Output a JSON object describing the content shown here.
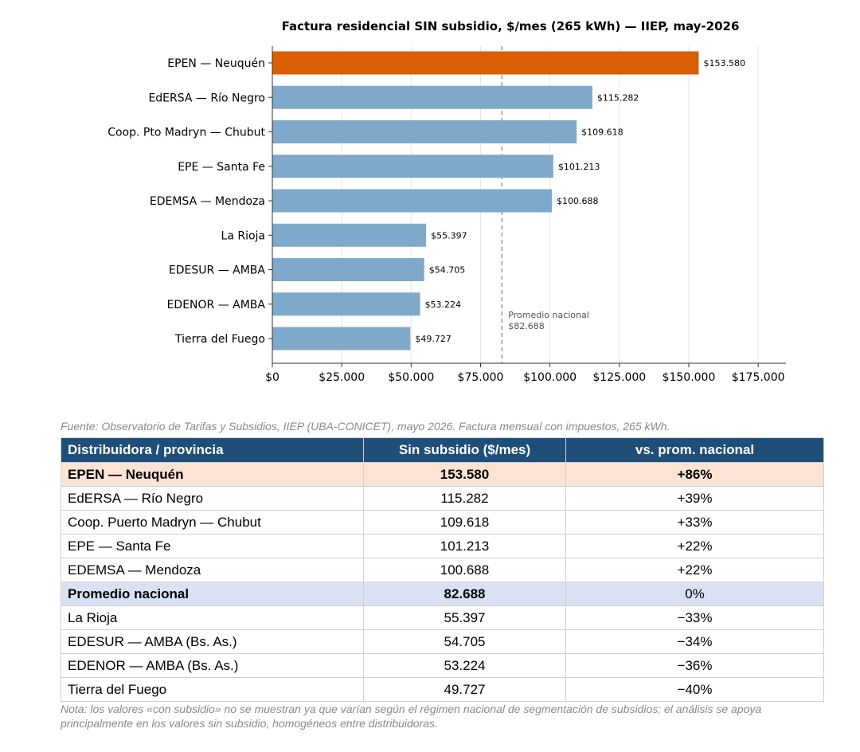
{
  "chart_data": {
    "type": "bar",
    "orientation": "horizontal",
    "title": "Factura residencial SIN subsidio, $/mes (265 kWh) — IIEP, may-2026",
    "categories": [
      "EPEN — Neuquén",
      "EdERSA — Río Negro",
      "Coop. Pto Madryn — Chubut",
      "EPE — Santa Fe",
      "EDEMSA — Mendoza",
      "La Rioja",
      "EDESUR — AMBA",
      "EDENOR — AMBA",
      "Tierra del Fuego"
    ],
    "values": [
      153580,
      115282,
      109618,
      101213,
      100688,
      55397,
      54705,
      53224,
      49727
    ],
    "value_labels": [
      "$153.580",
      "$115.282",
      "$109.618",
      "$101.213",
      "$100.688",
      "$55.397",
      "$54.705",
      "$53.224",
      "$49.727"
    ],
    "highlight_index": 0,
    "xlim": [
      0,
      185000
    ],
    "xticks": [
      0,
      25000,
      50000,
      75000,
      100000,
      125000,
      150000,
      175000
    ],
    "xtick_labels": [
      "$0",
      "$25.000",
      "$50.000",
      "$75.000",
      "$100.000",
      "$125.000",
      "$150.000",
      "$175.000"
    ],
    "reference_line": {
      "value": 82688,
      "label": "Promedio nacional",
      "value_label": "$82.688"
    },
    "grid": "vertical",
    "colors": {
      "bar": "#7fa9cb",
      "highlight": "#d95f02",
      "reference": "#999999",
      "grid": "#e6e6e6",
      "axis": "#333333"
    }
  },
  "source": "Fuente: Observatorio de Tarifas y Subsidios, IIEP (UBA-CONICET), mayo 2026. Factura mensual con impuestos, 265 kWh.",
  "table": {
    "headers": [
      "Distribuidora / provincia",
      "Sin subsidio ($/mes)",
      "vs. prom. nacional"
    ],
    "rows": [
      [
        "EPEN — Neuquén",
        "153.580",
        "+86%"
      ],
      [
        "EdERSA — Río Negro",
        "115.282",
        "+39%"
      ],
      [
        "Coop. Puerto Madryn — Chubut",
        "109.618",
        "+33%"
      ],
      [
        "EPE — Santa Fe",
        "101.213",
        "+22%"
      ],
      [
        "EDEMSA — Mendoza",
        "100.688",
        "+22%"
      ],
      [
        "Promedio nacional",
        "82.688",
        "0%"
      ],
      [
        "La Rioja",
        "55.397",
        "−33%"
      ],
      [
        "EDESUR — AMBA (Bs. As.)",
        "54.705",
        "−34%"
      ],
      [
        "EDENOR — AMBA (Bs. As.)",
        "53.224",
        "−36%"
      ],
      [
        "Tierra del Fuego",
        "49.727",
        "−40%"
      ]
    ],
    "row_styles": [
      "highlight",
      "",
      "",
      "",
      "",
      "average",
      "",
      "",
      "",
      ""
    ],
    "colors": {
      "header_bg": "#1f4e79",
      "highlight_bg": "#fbe3d6",
      "average_bg": "#dae1f3"
    }
  },
  "note": "Nota: los valores «con subsidio» no se muestran ya que varían según el régimen nacional de segmentación de subsidios; el análisis se apoya principalmente en los valores sin subsidio, homogéneos entre distribuidoras."
}
